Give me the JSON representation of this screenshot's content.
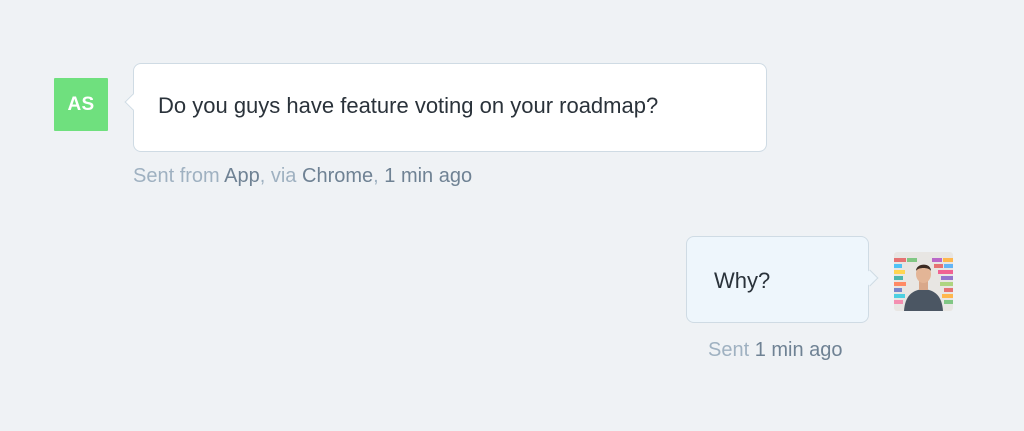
{
  "incoming": {
    "avatar_initials": "AS",
    "avatar_color": "#6fe07e",
    "message": "Do you guys have feature voting on your roadmap?",
    "meta": {
      "sent_from_label": "Sent from",
      "source_app": "App",
      "via_label": ", via",
      "browser": "Chrome",
      "separator": ",",
      "time": "1 min ago"
    }
  },
  "outgoing": {
    "message": "Why?",
    "meta": {
      "sent_label": "Sent",
      "time": "1 min ago"
    }
  },
  "colors": {
    "background": "#eff2f5",
    "incoming_bubble": "#ffffff",
    "outgoing_bubble": "#eef6fc",
    "bubble_border": "#cfdbe4",
    "meta_text": "#9fb1c1",
    "meta_strong": "#6f8294"
  },
  "icons": {
    "agent_avatar": "agent-photo-avatar"
  }
}
